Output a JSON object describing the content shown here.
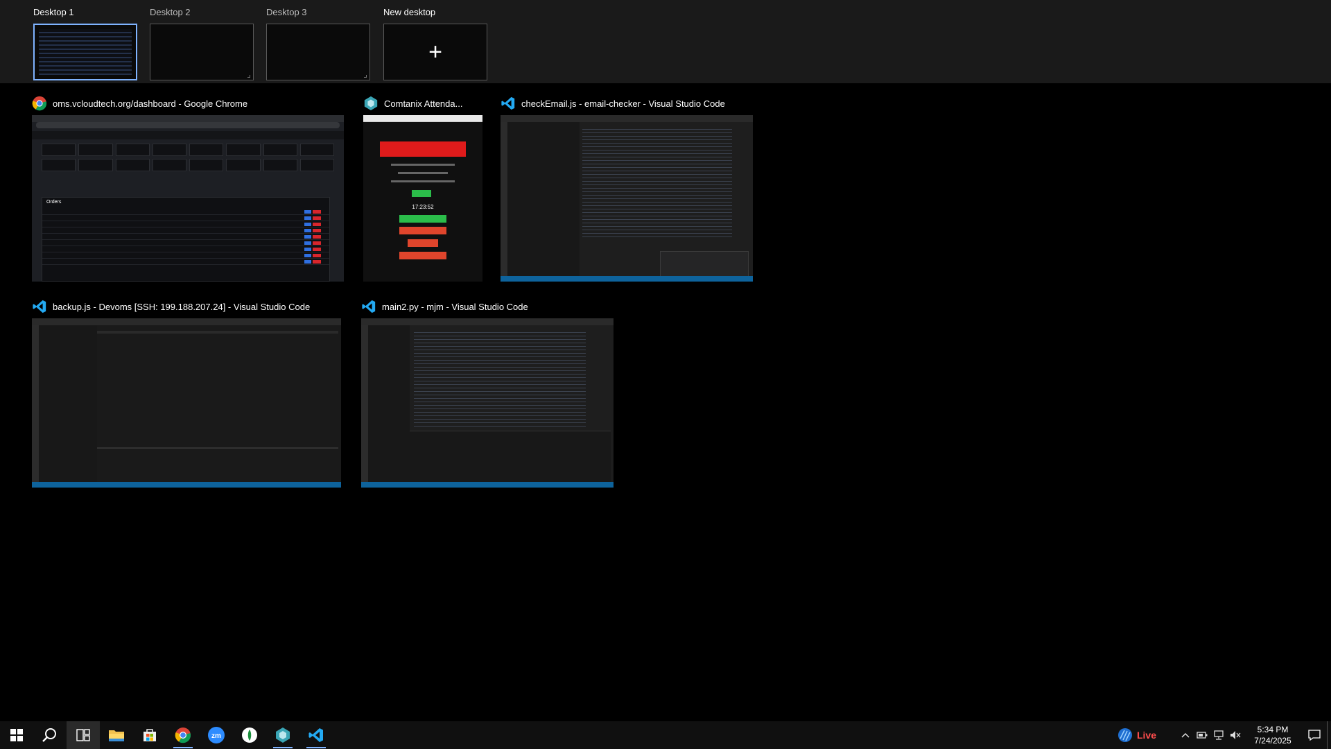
{
  "desktops": [
    {
      "label": "Desktop 1",
      "active": true
    },
    {
      "label": "Desktop 2",
      "active": false
    },
    {
      "label": "Desktop 3",
      "active": false
    },
    {
      "label": "New desktop",
      "active": false
    }
  ],
  "windows": [
    {
      "title": "oms.vcloudtech.org/dashboard - Google Chrome",
      "app": "chrome-icon"
    },
    {
      "title": "Comtanix Attenda...",
      "app": "comtanix-icon"
    },
    {
      "title": "checkEmail.js - email-checker - Visual Studio Code",
      "app": "vscode-icon"
    },
    {
      "title": "backup.js - Devoms [SSH: 199.188.207.24] - Visual Studio Code",
      "app": "vscode-icon"
    },
    {
      "title": "main2.py - mjm - Visual Studio Code",
      "app": "vscode-icon"
    }
  ],
  "attendance_preview": {
    "time": "17:23:52"
  },
  "dashboard_preview": {
    "section": "Orders"
  },
  "taskbar": {
    "items": [
      "windows-start-icon",
      "search-icon",
      "task-view-icon",
      "file-explorer-icon",
      "microsoft-store-icon",
      "chrome-icon",
      "zoom-icon",
      "app-icon",
      "comtanix-icon",
      "vscode-icon"
    ],
    "live_label": "Live",
    "clock_time": "5:34 PM",
    "clock_date": "7/24/2025"
  },
  "colors": {
    "accent": "#7fb3ff",
    "live_red": "#ff4d4d",
    "vscode_blue": "#0e639c"
  }
}
